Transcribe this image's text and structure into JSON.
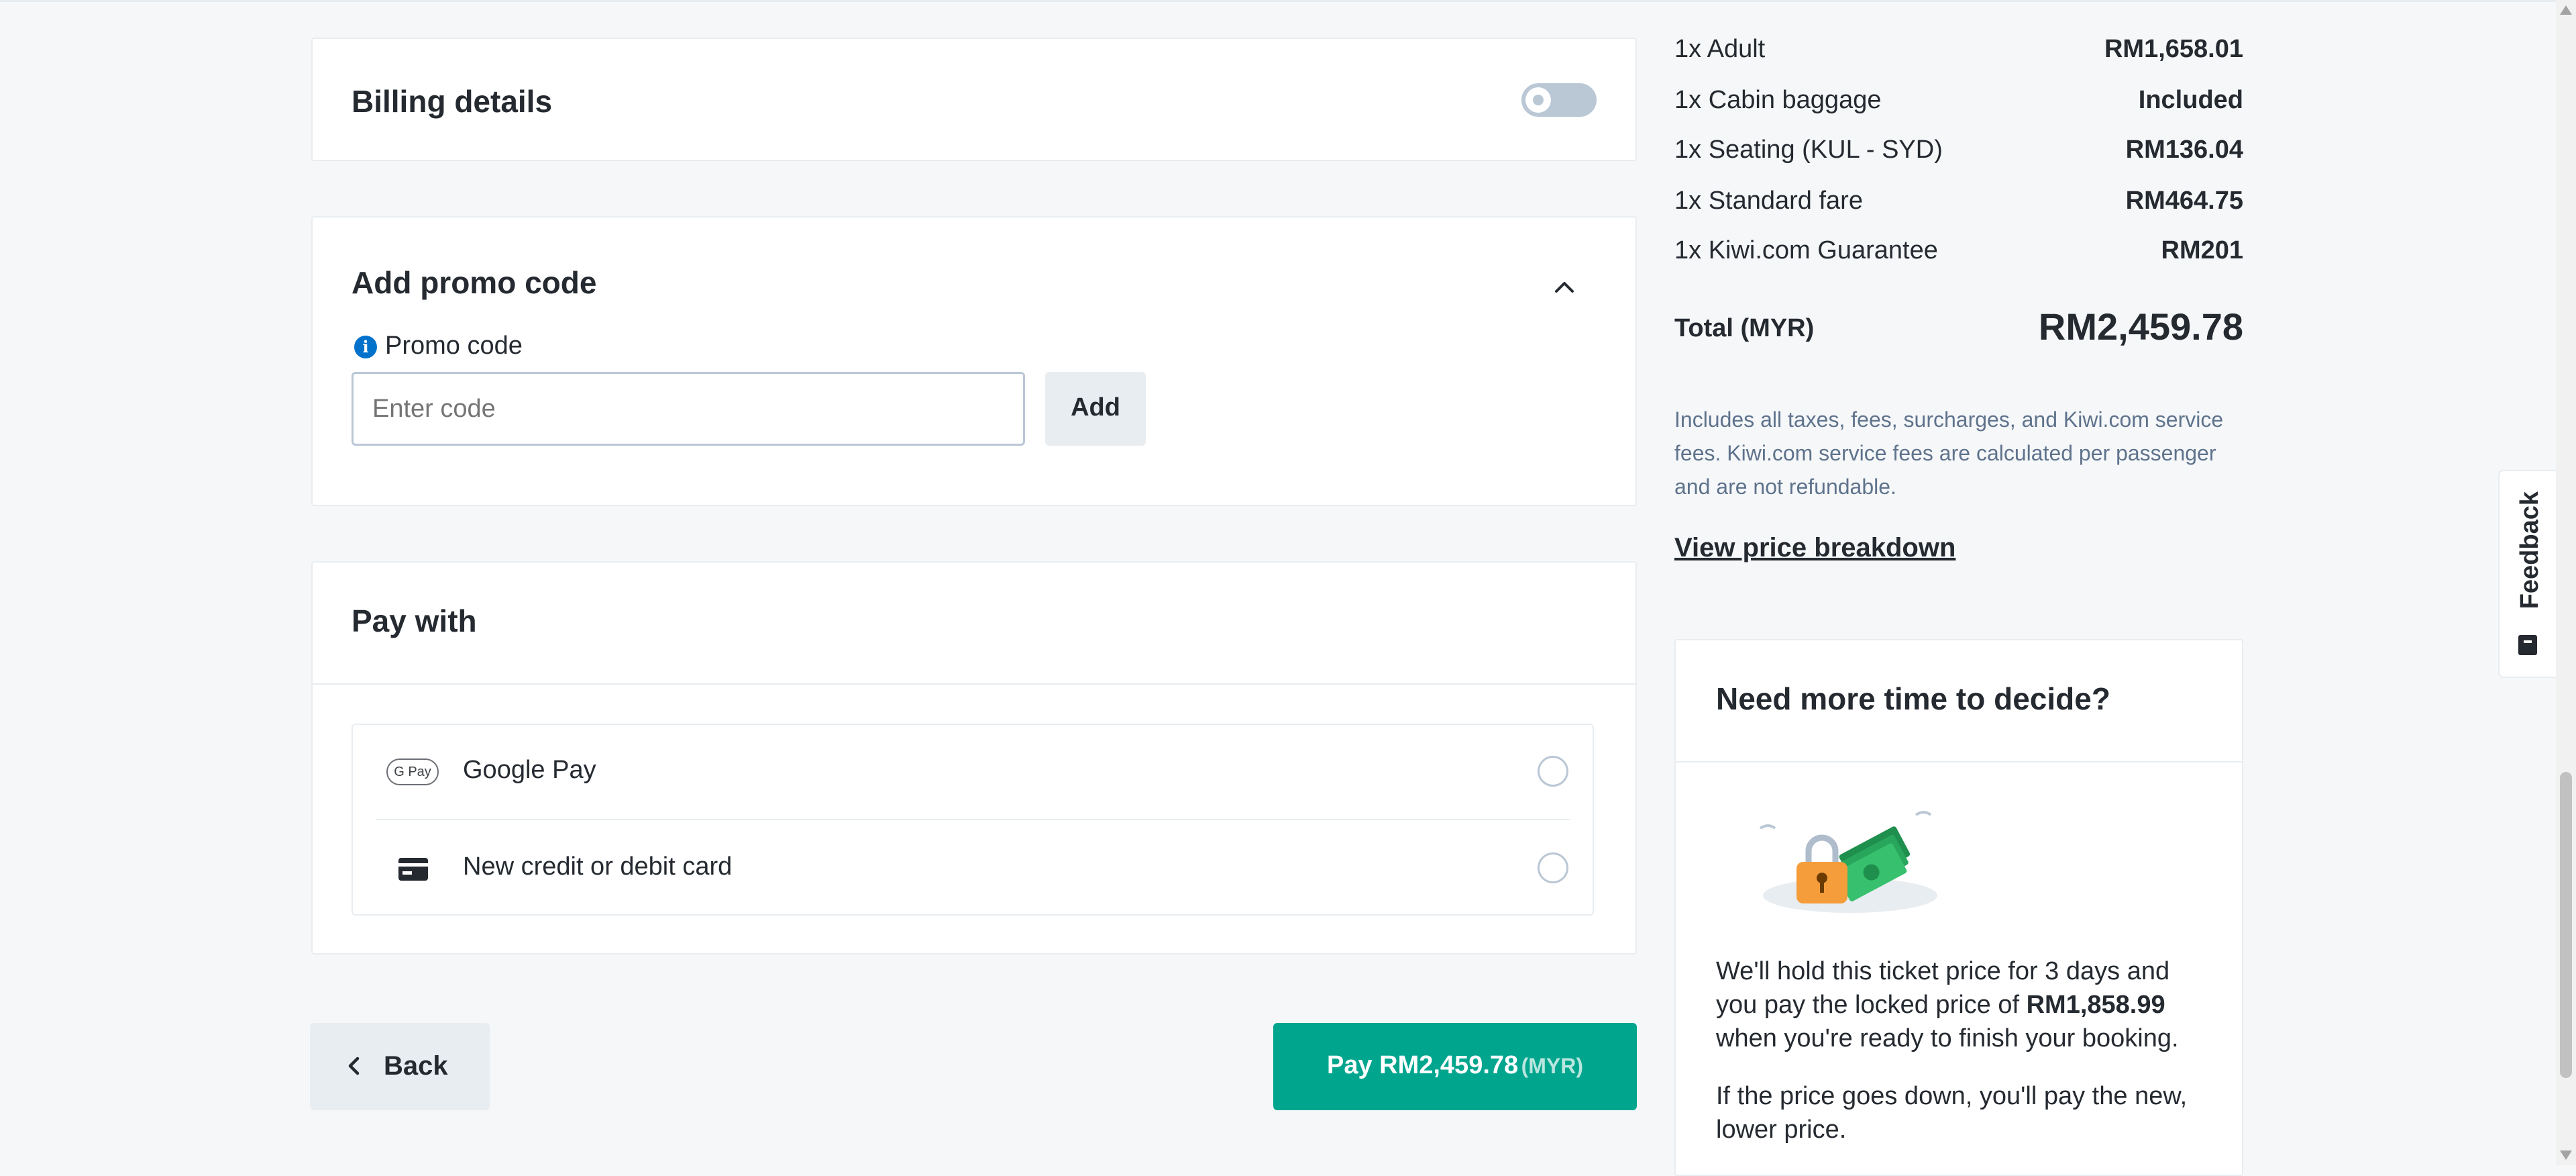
{
  "billing": {
    "title": "Billing details"
  },
  "promo": {
    "title": "Add promo code",
    "label": "Promo code",
    "placeholder": "Enter code",
    "add_label": "Add"
  },
  "pay_with": {
    "title": "Pay with",
    "options": [
      {
        "label": "Google Pay",
        "icon": "google-pay-icon",
        "icon_text": "G Pay"
      },
      {
        "label": "New credit or debit card",
        "icon": "credit-card-icon"
      }
    ]
  },
  "footer": {
    "back_label": "Back",
    "pay_label": "Pay RM2,459.78",
    "pay_currency": "(MYR)"
  },
  "summary": {
    "items": [
      {
        "label": "1x Adult",
        "value": "RM1,658.01"
      },
      {
        "label": "1x Cabin baggage",
        "value": "Included"
      },
      {
        "label": "1x Seating (KUL - SYD)",
        "value": "RM136.04"
      },
      {
        "label": "1x Standard fare",
        "value": "RM464.75"
      },
      {
        "label": "1x Kiwi.com Guarantee",
        "value": "RM201"
      }
    ],
    "total_label": "Total (MYR)",
    "total_value": "RM2,459.78",
    "note_lines": [
      "Includes all taxes, fees, surcharges, and Kiwi.com service",
      "fees. Kiwi.com service fees are calculated per passenger",
      "and are not refundable."
    ],
    "breakdown_link": "View price breakdown"
  },
  "hold": {
    "title": "Need more time to decide?",
    "p1_line1": "We'll hold this ticket price for 3 days and",
    "p1_line2_prefix": "you pay the locked price of ",
    "p1_price": "RM1,858.99",
    "p1_line3": "when you're ready to finish your booking.",
    "p2_line1": "If the price goes down, you'll pay the new,",
    "p2_line2": "lower price."
  },
  "feedback": {
    "label": "Feedback"
  },
  "colors": {
    "primary": "#00a58e",
    "info": "#0172cb"
  }
}
